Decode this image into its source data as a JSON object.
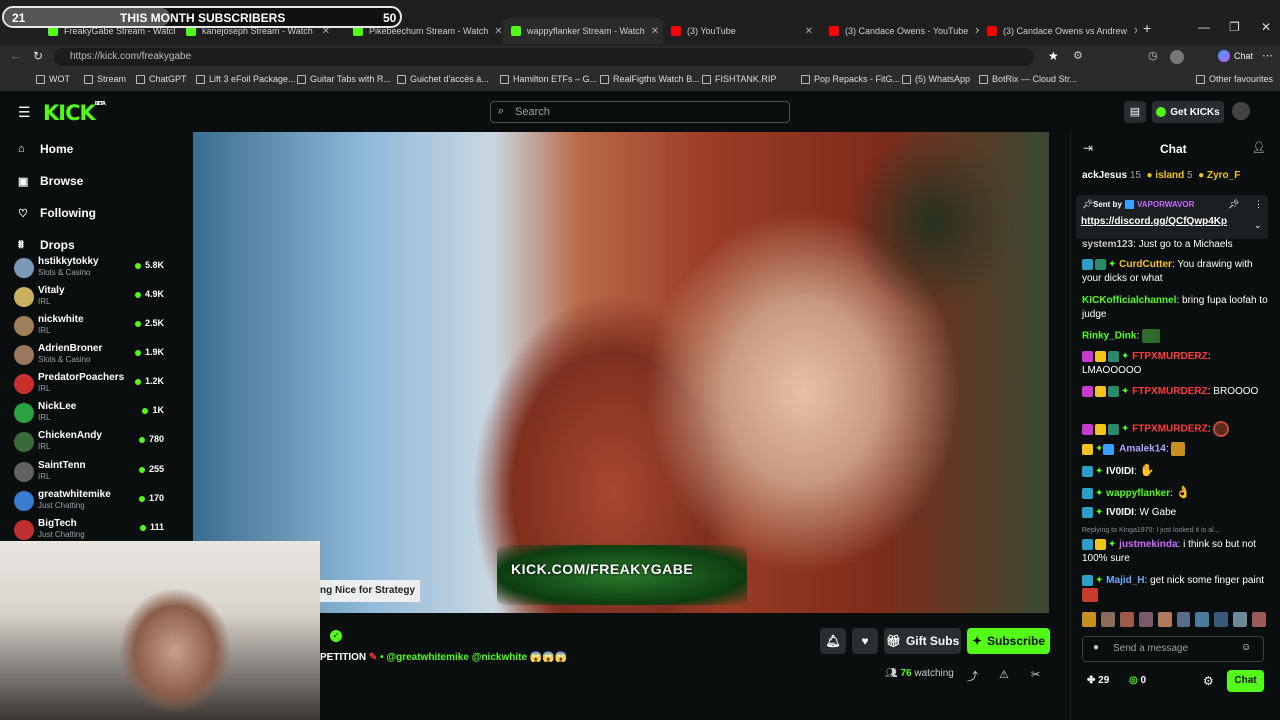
{
  "subs_overlay": {
    "current": "21",
    "title": "THIS MONTH SUBSCRIBERS",
    "goal": "50",
    "progress_fraction": 0.42
  },
  "tabs": [
    {
      "label": "FreakyGabe Stream - Watch",
      "color": "#53fc18"
    },
    {
      "label": "kanejoseph Stream - Watch",
      "color": "#53fc18"
    },
    {
      "label": "Pikebeechum Stream - Watch",
      "color": "#53fc18"
    },
    {
      "label": "wappyflanker Stream - Watch",
      "color": "#53fc18"
    },
    {
      "label": "(3) YouTube",
      "color": "#ff0000"
    },
    {
      "label": "(3) Candace Owens - YouTube",
      "color": "#ff0000"
    },
    {
      "label": "(3) Candace Owens vs Andrew",
      "color": "#ff0000"
    }
  ],
  "address": {
    "url": "https://kick.com/freakygabe",
    "chat_button": "Chat"
  },
  "bookmarks": [
    "WOT",
    "Stream",
    "ChatGPT",
    "Lift 3 eFoil Package...",
    "Guitar Tabs with R...",
    "Guichet d'accès à...",
    "Hamilton ETFs – G...",
    "RealFigths Watch B...",
    "FISHTANK.RIP",
    "Pop Repacks - FitG...",
    "(5) WhatsApp",
    "BotRix — Cloud Str...",
    "Other favourites"
  ],
  "kick": {
    "logo": "KICK",
    "logo_tag": "BETA",
    "search_placeholder": "Search",
    "get_kicks": "Get KICKs"
  },
  "nav": {
    "home": "Home",
    "browse": "Browse",
    "following": "Following",
    "drops": "Drops"
  },
  "channels": [
    {
      "name": "hstikkytokky",
      "category": "Slots & Casino",
      "viewers": "5.8K",
      "color": "#7a9ab8"
    },
    {
      "name": "Vitaly",
      "category": "IRL",
      "viewers": "4.9K",
      "color": "#c8b060"
    },
    {
      "name": "nickwhite",
      "category": "IRL",
      "viewers": "2.5K",
      "color": "#a0805a"
    },
    {
      "name": "AdrienBroner",
      "category": "Slots & Casino",
      "viewers": "1.9K",
      "color": "#9a7860"
    },
    {
      "name": "PredatorPoachers",
      "category": "IRL",
      "viewers": "1.2K",
      "color": "#c83030"
    },
    {
      "name": "NickLee",
      "category": "IRL",
      "viewers": "1K",
      "color": "#2aa040"
    },
    {
      "name": "ChickenAndy",
      "category": "IRL",
      "viewers": "780",
      "color": "#3a6a3a"
    },
    {
      "name": "SaintTenn",
      "category": "IRL",
      "viewers": "255",
      "color": "#606060"
    },
    {
      "name": "greatwhitemike",
      "category": "Just Chatting",
      "viewers": "170",
      "color": "#3a7ad0"
    },
    {
      "name": "BigTech",
      "category": "Just Chatting",
      "viewers": "111",
      "color": "#c03030"
    }
  ],
  "video": {
    "banner": "KICK.COM/FREAKYGABE",
    "caption_overlay": "ng Nice for Strategy",
    "title_fragment": "PETITION",
    "mentions": "• @greatwhitemike @nickwhite",
    "watching_count": "76",
    "watching_label": "watching",
    "gift_subs": "Gift Subs",
    "subscribe": "Subscribe"
  },
  "chat": {
    "title": "Chat",
    "top_gifters": [
      {
        "name": "ackJesus",
        "count": "15"
      },
      {
        "name": "island",
        "count": "5"
      },
      {
        "name": "Zyro_F",
        "count": ""
      }
    ],
    "pinned": {
      "sent_by_label": "Sent by",
      "sender": "VAPORWAVOR",
      "link": "https://discord.gg/QCfQwp4Kp"
    },
    "messages": [
      {
        "user": "system123",
        "user_color": "#c8c8c8",
        "text": "Just go to a Michaels"
      },
      {
        "user": "CurdCutter",
        "user_color": "#f0c419",
        "text": "You drawing with your dicks or what"
      },
      {
        "user": "KICKofficialchannel",
        "user_color": "#53fc18",
        "text": "bring fupa loofah to judge"
      },
      {
        "user": "Rinky_Dink",
        "user_color": "#53fc18",
        "text": ""
      },
      {
        "user": "FTPXMURDERZ",
        "user_color": "#ff3b3b",
        "text": "LMAOOOOO"
      },
      {
        "user": "FTPXMURDERZ",
        "user_color": "#ff3b3b",
        "text": "BROOOO"
      },
      {
        "user": "FTPXMURDERZ",
        "user_color": "#ff3b3b",
        "text": ""
      },
      {
        "user": "Amalek14",
        "user_color": "#b5a4ff",
        "text": ""
      },
      {
        "user": "IV0IDI",
        "user_color": "#ffffff",
        "text": ""
      },
      {
        "user": "wappyflanker",
        "user_color": "#53fc18",
        "text": ""
      },
      {
        "user": "IV0IDI",
        "user_color": "#ffffff",
        "text": "W Gabe"
      },
      {
        "user": "justmekinda",
        "user_color": "#c66bff",
        "text": "i think so but not 100% sure",
        "reply": "Replying to Kinga1970: I just looked it is al..."
      },
      {
        "user": "Majid_H",
        "user_color": "#6ea8ff",
        "text": "get nick some finger paint"
      }
    ],
    "input_placeholder": "Send a message",
    "kicks_count": "29",
    "points_count": "0",
    "send_button": "Chat"
  },
  "colors": {
    "kick_green": "#53fc18",
    "bg": "#0b0e0f"
  }
}
